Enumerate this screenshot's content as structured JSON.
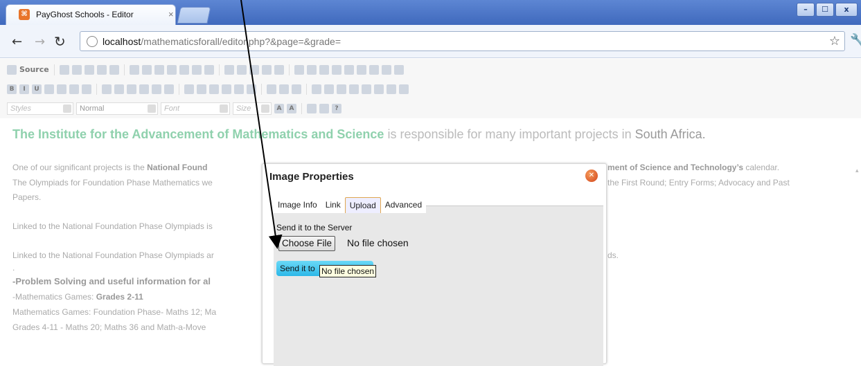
{
  "browser": {
    "tab_title": "PayGhost Schools - Editor",
    "tab_close": "×",
    "url_host": "localhost",
    "url_path": "/mathematicsforall/editor.php?&page=&grade=",
    "window_buttons": {
      "minimize": "–",
      "maximize": "☐",
      "close": "x"
    }
  },
  "editor": {
    "toolbar_row1": [
      "Source"
    ],
    "styles_placeholder": "Styles",
    "format_value": "Normal",
    "font_placeholder": "Font",
    "size_placeholder": "Size"
  },
  "content": {
    "headline_bold": "The Institute for the Advancement of Mathematics and Science",
    "headline_rest": " is responsible for many important projects in ",
    "headline_place": "South Africa.",
    "p1_left": "One of our significant projects is the ",
    "p1_bold": "National Found",
    "p1_right_bold": "ment of Science and Technology’s",
    "p1_right": " calendar.",
    "p2_left": "The Olympiads for Foundation Phase Mathematics we",
    "p2_right": "the First Round; Entry Forms; Advocacy and Past",
    "p3": "Papers.",
    "p4": "Linked to the National Foundation Phase Olympiads is",
    "p5_left": "Linked to the National Foundation Phase Olympiads ar",
    "p5_right": "ds.",
    "p6": ".",
    "p7": "-Problem Solving and useful information for al",
    "p8_left": "-Mathematics Games: ",
    "p8_bold": "Grades 2-11",
    "p9": "Mathematics Games: Foundation Phase- Maths 12; Ma",
    "p10": "Grades 4-11 - Maths 20; Maths 36 and Math-a-Move"
  },
  "dialog": {
    "title": "Image Properties",
    "tabs": [
      "Image Info",
      "Link",
      "Upload",
      "Advanced"
    ],
    "selected_tab": "Upload",
    "send_label": "Send it to the Server",
    "choose_file": "Choose File",
    "no_file": "No file chosen",
    "send_button": "Send it to",
    "tooltip": "No file chosen"
  },
  "colors": {
    "accent_green": "#8fd1ad",
    "send_button": "#2cb8e8",
    "title_bar": "#4a74c4"
  }
}
